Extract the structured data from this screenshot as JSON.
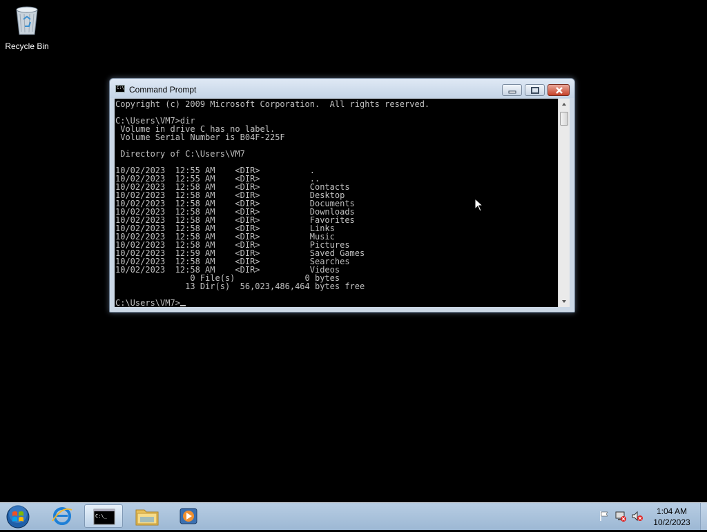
{
  "desktop": {
    "icons": [
      {
        "label": "Recycle Bin",
        "icon": "recycle-bin-icon"
      }
    ]
  },
  "window": {
    "title": "Command Prompt",
    "icon": "cmd-icon",
    "controls": {
      "minimize": "minimize-icon",
      "maximize": "maximize-icon",
      "close": "close-icon"
    },
    "console": {
      "lines": [
        "Copyright (c) 2009 Microsoft Corporation.  All rights reserved.",
        "",
        "C:\\Users\\VM7>dir",
        " Volume in drive C has no label.",
        " Volume Serial Number is B04F-225F",
        "",
        " Directory of C:\\Users\\VM7",
        "",
        "10/02/2023  12:55 AM    <DIR>          .",
        "10/02/2023  12:55 AM    <DIR>          ..",
        "10/02/2023  12:58 AM    <DIR>          Contacts",
        "10/02/2023  12:58 AM    <DIR>          Desktop",
        "10/02/2023  12:58 AM    <DIR>          Documents",
        "10/02/2023  12:58 AM    <DIR>          Downloads",
        "10/02/2023  12:58 AM    <DIR>          Favorites",
        "10/02/2023  12:58 AM    <DIR>          Links",
        "10/02/2023  12:58 AM    <DIR>          Music",
        "10/02/2023  12:58 AM    <DIR>          Pictures",
        "10/02/2023  12:59 AM    <DIR>          Saved Games",
        "10/02/2023  12:58 AM    <DIR>          Searches",
        "10/02/2023  12:58 AM    <DIR>          Videos",
        "               0 File(s)              0 bytes",
        "              13 Dir(s)  56,023,486,464 bytes free",
        ""
      ],
      "prompt": "C:\\Users\\VM7>",
      "colors": {
        "background": "#000000",
        "text": "#c0c0c0"
      }
    }
  },
  "taskbar": {
    "start_icon": "windows-start-orb-icon",
    "pinned": [
      {
        "icon": "internet-explorer-icon",
        "active": false
      },
      {
        "icon": "command-prompt-icon",
        "active": true
      },
      {
        "icon": "windows-explorer-icon",
        "active": false
      },
      {
        "icon": "media-player-icon",
        "active": false
      }
    ],
    "tray": {
      "icons": [
        "action-center-flag-icon",
        "network-disconnected-icon",
        "volume-muted-icon"
      ],
      "time": "1:04 AM",
      "date": "10/2/2023"
    }
  }
}
